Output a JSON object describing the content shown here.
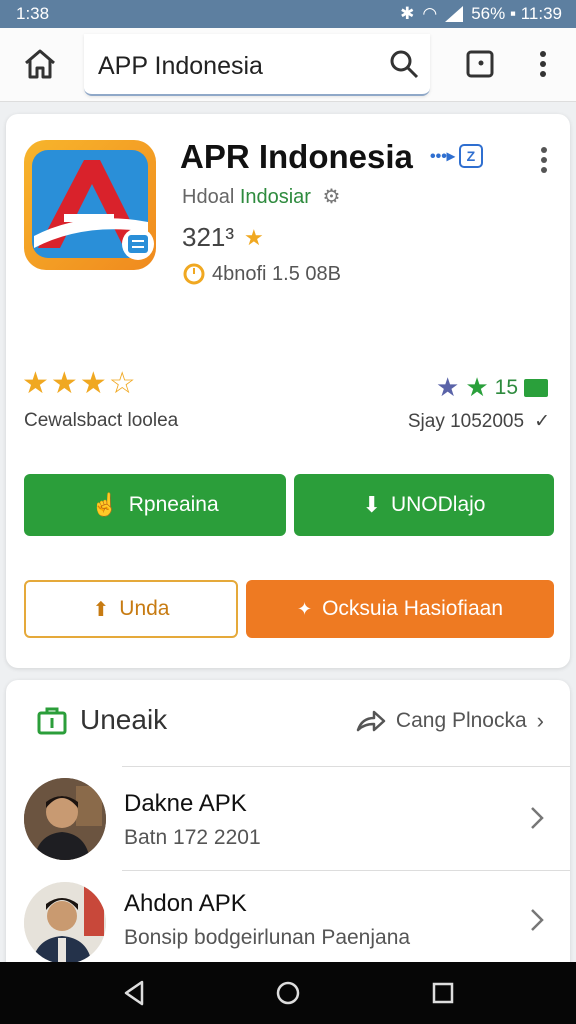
{
  "status_bar": {
    "time": "1:38",
    "right_text": "56% ▪ 11:39"
  },
  "toolbar": {
    "search_value": "APP Indonesia"
  },
  "app": {
    "title": "APR Indonesia",
    "badge_text": "•••▸",
    "badge_box": "Z",
    "developer_prefix": "Hdoal ",
    "developer_name": "Indosiar",
    "version": "321³",
    "size": "4bnofi 1.5 08B",
    "stars": [
      "★",
      "★",
      "★",
      "☆"
    ],
    "rating_label": "Cewalsbact loolea",
    "review_count": "15",
    "date": "Sjay 1052005",
    "buttons": {
      "primary": "Rpneaina",
      "download": "UNODlajo",
      "outline": "Unda",
      "orange": "Ocksuia Hasiofiaan"
    }
  },
  "section": {
    "title": "Uneaik",
    "action": "Cang Plnocka",
    "items": [
      {
        "title": "Dakne APK",
        "subtitle": "Batn 172 2201"
      },
      {
        "title": "Ahdon APK",
        "subtitle": "Bonsip bodgeirlunan Paenjana"
      }
    ]
  },
  "colors": {
    "accent_green": "#2b9e3a",
    "accent_orange": "#ee7a22",
    "status_bar": "#5d7fa0"
  }
}
